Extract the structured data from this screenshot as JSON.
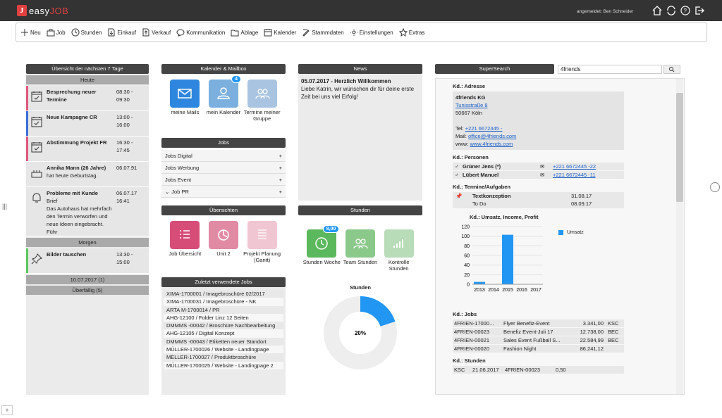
{
  "app": {
    "logo_letter": "J",
    "brand_a": "easy",
    "brand_b": "JOB",
    "user": "angemeldet: Ben Schneider"
  },
  "toolbar": [
    "Neu",
    "Job",
    "Stunden",
    "Einkauf",
    "Verkauf",
    "Kommunikation",
    "Ablage",
    "Kalender",
    "Stammdaten",
    "Einstellungen",
    "Extras"
  ],
  "overview": {
    "title": "Übersicht der nächsten 7 Tage",
    "today": "Heute",
    "tomorrow": "Morgen",
    "events": [
      {
        "title": "Besprechung neuer Termine",
        "time": "08:30 - 09:30",
        "color": "#e05880"
      },
      {
        "title": "Neue Kampagne CR",
        "time": "13:00 - 16:00",
        "color": "#3a6fd8"
      },
      {
        "title": "Abstimmung Projekt FR",
        "time": "16:30 - 17:45",
        "color": "#e05880"
      }
    ],
    "birthday": {
      "title": "Annika Mann (26 Jahre)",
      "text": "hat heute Geburtstag.",
      "date": "06.07.91"
    },
    "problem": {
      "title": "Probleme mit Kunde",
      "sub": "Brief",
      "text": "Das Autohaus hat mehrfach den Termin verworfen und neue Ideen eingebracht. Führ",
      "date": "06.07.17",
      "time": "16:41"
    },
    "tomorrow_event": {
      "title": "Bilder tauschen",
      "time": "13:30 - 15:00",
      "color": "#5cc85c"
    },
    "later": "10.07.2017 (1)",
    "overdue": "Überfällig (5)"
  },
  "kalender": {
    "title": "Kalender & Mailbox",
    "tiles": [
      {
        "label": "meine Mails",
        "color": "#2e86de"
      },
      {
        "label": "mein Kalender",
        "color": "#7bb0de",
        "badge": "4"
      },
      {
        "label": "Termine meiner Gruppe",
        "color": "#a9c4e0"
      }
    ]
  },
  "jobs": {
    "title": "Jobs",
    "items": [
      "Jobs Digital",
      "Jobs Werbung",
      "Jobs Event",
      "Job PR"
    ]
  },
  "uebersichten": {
    "title": "Übersichten",
    "tiles": [
      {
        "label": "Job Übersicht",
        "color": "#d64d78"
      },
      {
        "label": "Unit 2",
        "color": "#e08aa4"
      },
      {
        "label": "Projekt Planung (Gantt)",
        "color": "#f0c6d2"
      }
    ]
  },
  "recent": {
    "title": "Zuletzt verwendete Jobs",
    "items": [
      "XIMA-1700001 / Imagebroschüre 02/2017",
      "XIMA-1700031 / Imagebroschüre - NK",
      "ARTA M-1700014 / PR",
      "AHG-12100 / Folder Linz 12 Seiten",
      "DMMMS -00042 / Broschüre Nachbearbeitung",
      "AHG-12105 / Digital Konzept",
      "DMMMS -00043 / Etiketten neuer Standort",
      "MÜLLER-1700026 / Website - Landingpage",
      "MELLER-1700027 / Produktbroschüre",
      "MÜLLER-1700025 / Website - Landingpage 2"
    ]
  },
  "news": {
    "title": "News",
    "heading": "05.07.2017 - Herzlich Willkommen",
    "body": "Liebe Katrin, wir wünschen dir für deine erste Zeit bei uns viel Erfolg!"
  },
  "stunden": {
    "title": "Stunden",
    "tiles": [
      {
        "label": "Stunden Woche",
        "color": "#5cb85c",
        "badge": "8,00"
      },
      {
        "label": "Team Stunden",
        "color": "#8bc98b"
      },
      {
        "label": "Kontrolle Stunden",
        "color": "#b7dcb7"
      }
    ],
    "chart_title": "Stunden",
    "donut_label": "20%"
  },
  "supersearch": {
    "title": "SuperSearch",
    "query": "4friends",
    "adresse": {
      "label": "Kd.: Adresse",
      "name": "4friends KG",
      "street": "Tunisstraße 8",
      "city": "50667 Köln",
      "tel_label": "Tel:",
      "tel": "+221 6672445 -",
      "mail_label": "Mail:",
      "mail": "office@4friends.com",
      "www_label": "www:",
      "www": "www.4friends.com"
    },
    "personen": {
      "label": "Kd.: Personen",
      "items": [
        {
          "name": "Grüner Jens (*)",
          "phone": "+221 6672445 -22"
        },
        {
          "name": "Lübert Manuel",
          "phone": "+221 6672445 -11"
        }
      ]
    },
    "termine": {
      "label": "Kd.: Termine/Aufgaben",
      "title": "Textkonzeption",
      "type": "To Do",
      "d1": "31.08.17",
      "d2": "08.09.17"
    },
    "jobs_label": "Kd.: Jobs",
    "jobs": [
      [
        "4FRIEN-17000...",
        "Flyer Benefiz-Event",
        "3.341,00",
        "KSC"
      ],
      [
        "4FRIEN-00023",
        "Benefiz Event-Juli 17",
        "12.738,00",
        "BEC"
      ],
      [
        "4FRIEN-00021",
        "Sales Event Fußball S...",
        "22.584,99",
        "BEC"
      ],
      [
        "4FRIEN-00020",
        "Fashion Night",
        "86.241,12",
        ""
      ]
    ],
    "stunden_label": "Kd.: Stunden",
    "stunden_row": [
      "KSC",
      "21.06.2017",
      "4FRIEN-00023",
      "0,50"
    ]
  },
  "chart_data": {
    "type": "bar",
    "title": "Kd.: Umsatz, Income, Profit",
    "categories": [
      "2013",
      "2014",
      "2015",
      "2016",
      "2017"
    ],
    "series": [
      {
        "name": "Umsatz",
        "values": [
          5,
          0,
          103,
          0,
          0
        ]
      }
    ],
    "ylim": [
      0,
      120
    ],
    "yticks": [
      0,
      20,
      40,
      60,
      80,
      100,
      120
    ],
    "legend": "right",
    "color": "#2196f3"
  }
}
